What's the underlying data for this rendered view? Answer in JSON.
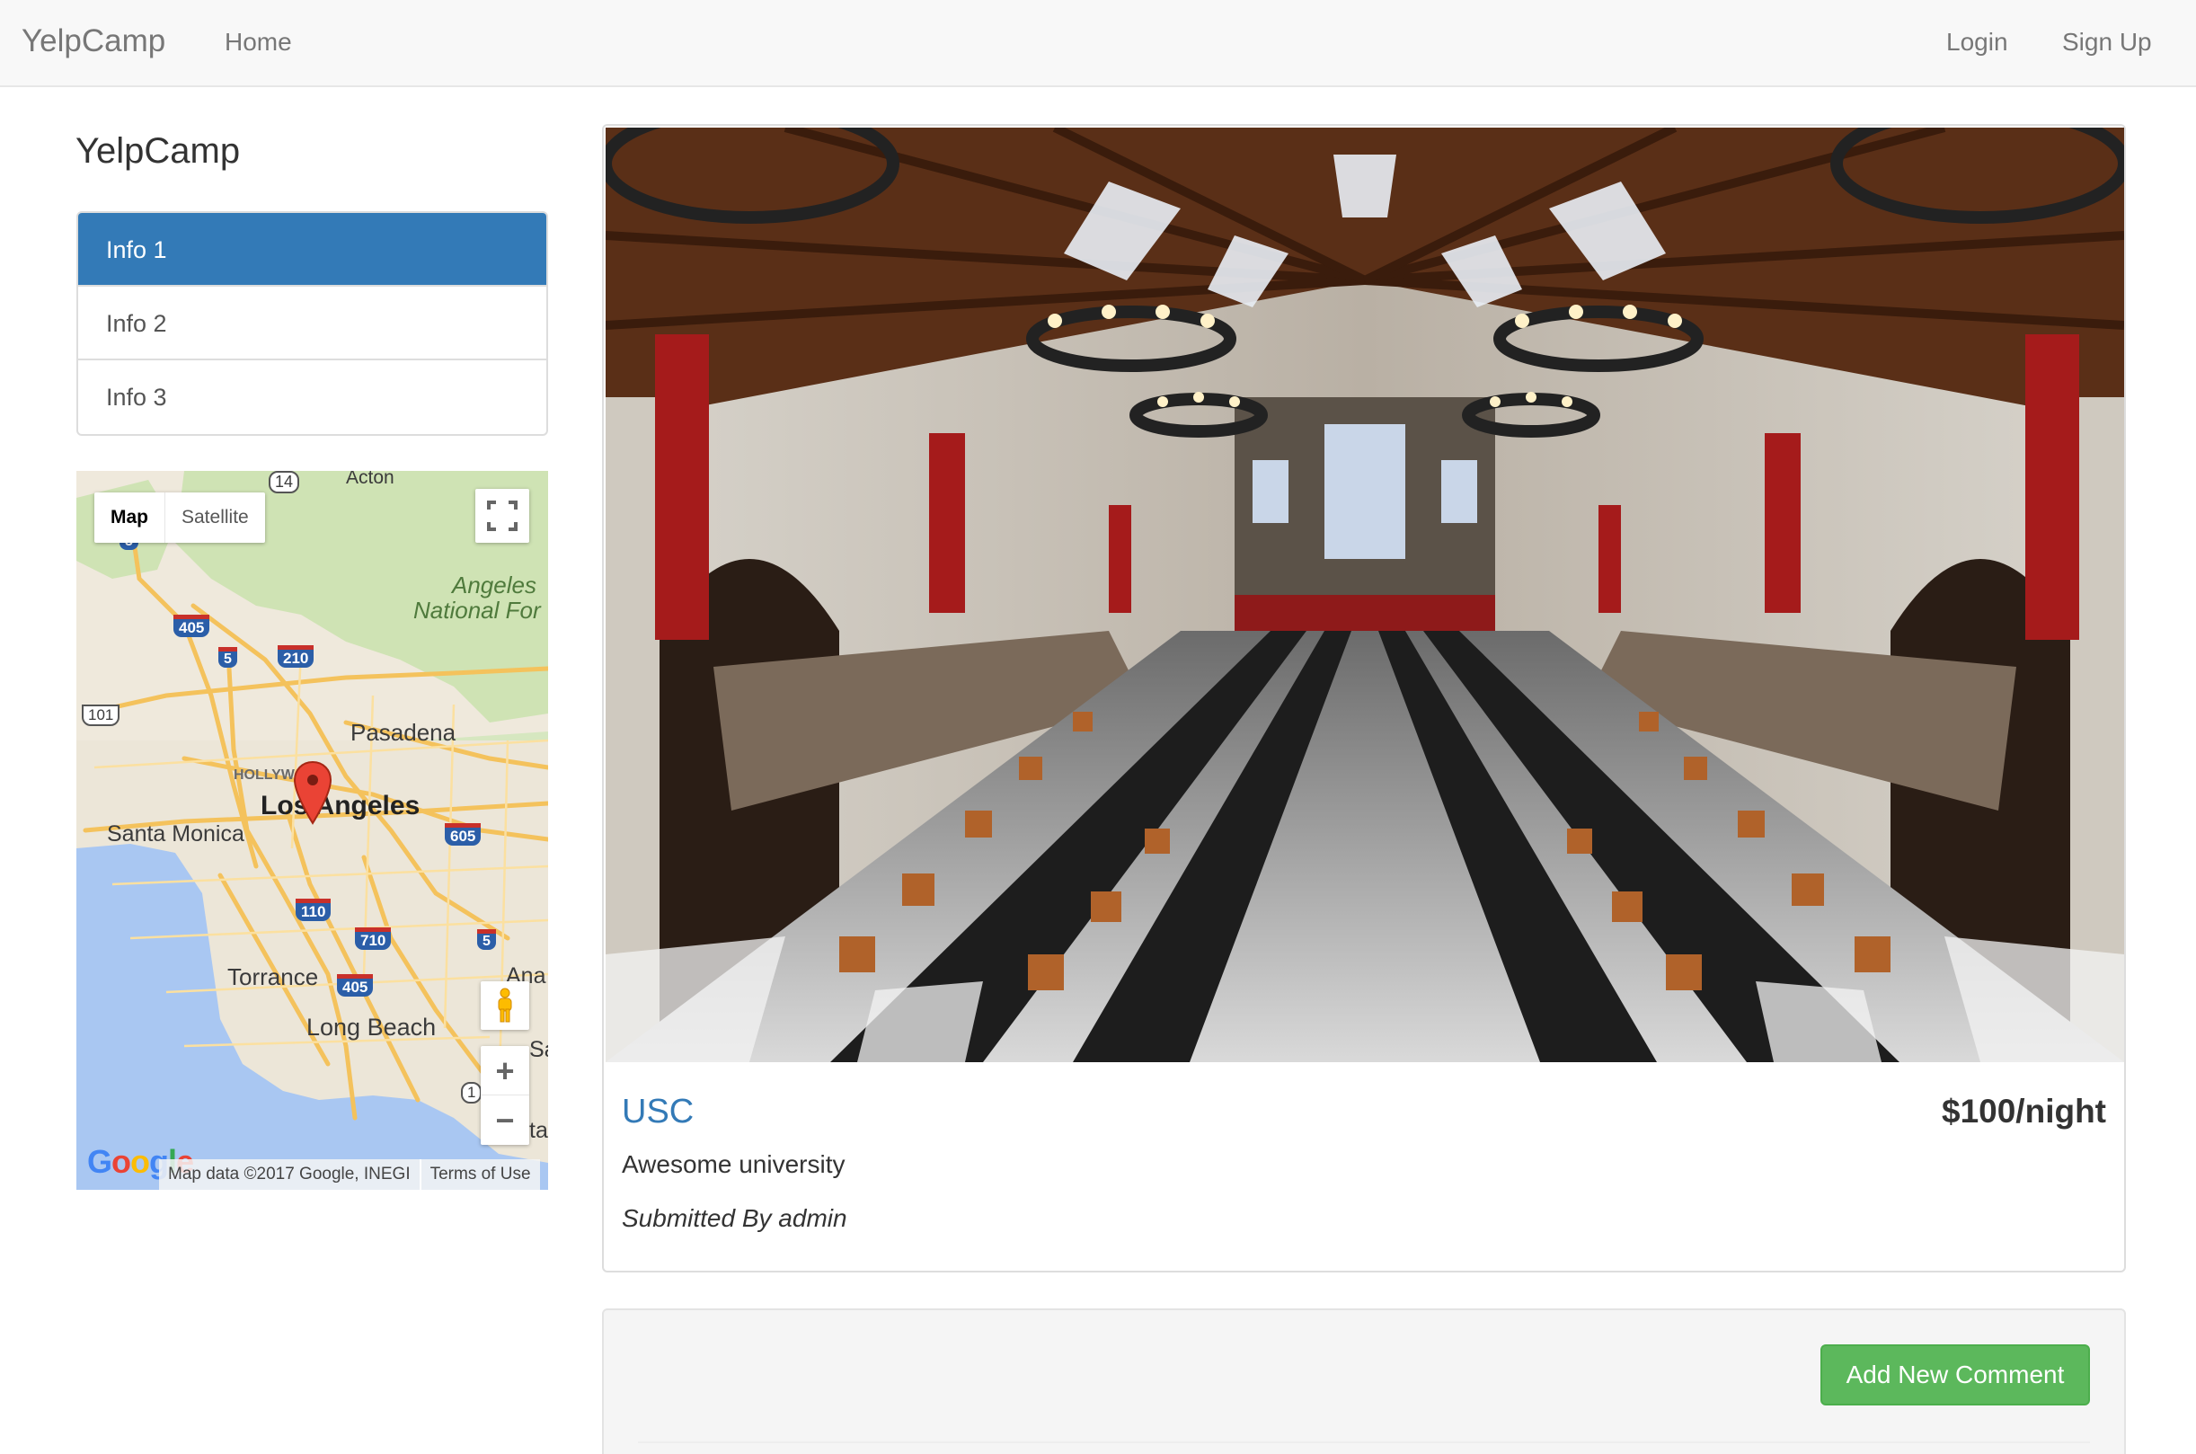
{
  "navbar": {
    "brand": "YelpCamp",
    "home": "Home",
    "login": "Login",
    "signup": "Sign Up"
  },
  "sidebar": {
    "title": "YelpCamp",
    "items": [
      {
        "label": "Info 1",
        "active": true
      },
      {
        "label": "Info 2",
        "active": false
      },
      {
        "label": "Info 3",
        "active": false
      }
    ]
  },
  "map": {
    "type_map": "Map",
    "type_satellite": "Satellite",
    "labels": {
      "acton": "Acton",
      "angeles_nf_1": "Angeles",
      "angeles_nf_2": "National For",
      "pasadena": "Pasadena",
      "hollywood": "HOLLYW",
      "los_angeles": "Los Angeles",
      "santa_monica": "Santa Monica",
      "torrance": "Torrance",
      "long_beach": "Long Beach",
      "ana": "Ana",
      "sa": "Sa",
      "ta": "ta"
    },
    "shields": {
      "h14": "14",
      "h5a": "5",
      "h405a": "405",
      "h5b": "5",
      "h210": "210",
      "h101": "101",
      "h605": "605",
      "h110": "110",
      "h710": "710",
      "h5c": "5",
      "h405b": "405",
      "h1": "1"
    },
    "google_logo": "Google",
    "attribution": "Map data ©2017 Google, INEGI",
    "terms": "Terms of Use",
    "colors": {
      "land": "#efe9dc",
      "water": "#a9c7f2",
      "park": "#cfe3b4",
      "road": "#f4c25c"
    }
  },
  "campground": {
    "name": "USC",
    "price": "$100/night",
    "description": "Awesome university",
    "author": "Submitted By admin"
  },
  "comments": {
    "add_button": "Add New Comment"
  }
}
